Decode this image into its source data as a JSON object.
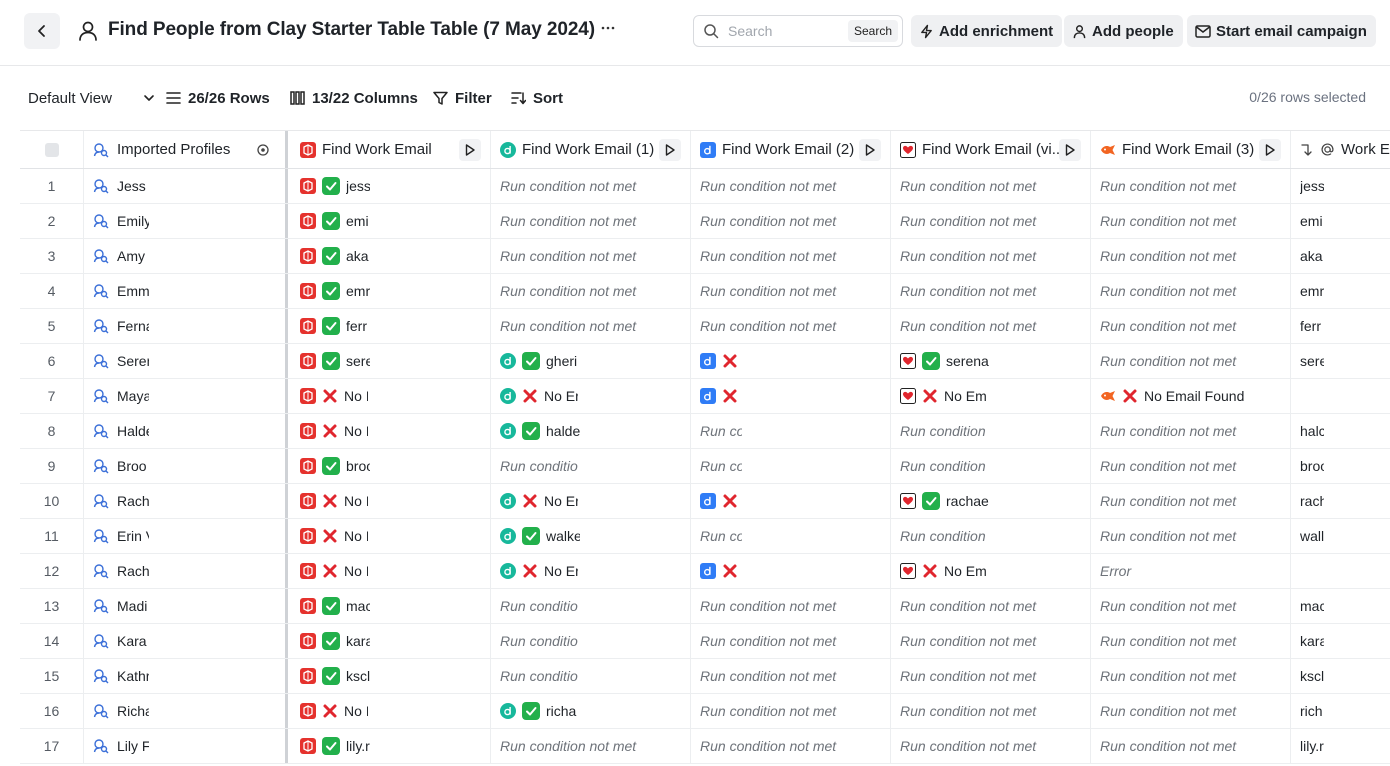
{
  "header": {
    "title": "Find People from Clay Starter Table Table (7 May 2024)",
    "search_placeholder": "Search",
    "search_button": "Search",
    "add_enrichment": "Add enrichment",
    "add_people": "Add people",
    "start_campaign": "Start email campaign"
  },
  "toolbar": {
    "view": "Default View",
    "rows": "26/26 Rows",
    "columns": "13/22 Columns",
    "filter": "Filter",
    "sort": "Sort",
    "rows_selected": "0/26 rows selected"
  },
  "colors": {
    "clay_red": "#e5322d",
    "dropcontact_teal": "#17b89b",
    "datagma_blue": "#2f7cf6",
    "hunter_orange": "#f26522",
    "check_green": "#22b04b",
    "x_red": "#e0262e"
  },
  "columns": {
    "profiles": "Imported Profiles",
    "e0": "Find Work Email",
    "e1": "Find Work Email (1)",
    "e2": "Find Work Email (2)",
    "e3": "Find Work Email (vi...",
    "e4": "Find Work Email (3)",
    "we": "Work E"
  },
  "text": {
    "cond": "Run condition not met",
    "cond_trunc_a": "Run conditic",
    "cond_trunc_b": "Run cc",
    "cond_trunc_c": "Run condition",
    "no_email": "No Email Found",
    "error": "Error"
  },
  "rows": [
    {
      "n": "1",
      "name": "Jess",
      "e0": "jess",
      "e0s": "ok",
      "e1": "cond",
      "e2": "cond",
      "e3": "cond",
      "e4": "cond",
      "we": "jess"
    },
    {
      "n": "2",
      "name": "Emily",
      "e0": "emi",
      "e0s": "ok",
      "e1": "cond",
      "e2": "cond",
      "e3": "cond",
      "e4": "cond",
      "we": "emi"
    },
    {
      "n": "3",
      "name": "Amy",
      "e0": "aka",
      "e0s": "ok",
      "e1": "cond",
      "e2": "cond",
      "e3": "cond",
      "e4": "cond",
      "we": "aka"
    },
    {
      "n": "4",
      "name": "Emm",
      "e0": "emr",
      "e0s": "ok",
      "e1": "cond",
      "e2": "cond",
      "e3": "cond",
      "e4": "cond",
      "we": "emr"
    },
    {
      "n": "5",
      "name": "Ferna",
      "e0": "ferr",
      "e0s": "ok",
      "e1": "cond",
      "e2": "cond",
      "e3": "cond",
      "e4": "cond",
      "we": "ferr"
    },
    {
      "n": "6",
      "name": "Seren",
      "e0": "sere",
      "e0s": "ok",
      "e1": "gheri",
      "e1s": "ok",
      "e2": "",
      "e2s": "x",
      "e3": "serena",
      "e3s": "ok",
      "e4": "cond",
      "we": "sere"
    },
    {
      "n": "7",
      "name": "Maya",
      "e0": "No I",
      "e0s": "x",
      "e1": "No Er",
      "e1s": "x",
      "e2": "",
      "e2s": "x",
      "e3": "No Em",
      "e3s": "x",
      "e4": "No Email Found",
      "e4s": "x",
      "we": ""
    },
    {
      "n": "8",
      "name": "Halde",
      "e0": "No I",
      "e0s": "x",
      "e1": "halde",
      "e1s": "ok",
      "e2": "condb",
      "e3": "condc",
      "e4": "cond",
      "we": "halc"
    },
    {
      "n": "9",
      "name": "Broo",
      "e0": "broo",
      "e0s": "ok",
      "e1": "conda",
      "e2": "condb",
      "e3": "condc",
      "e4": "cond",
      "we": "broo"
    },
    {
      "n": "10",
      "name": "Rach",
      "e0": "No I",
      "e0s": "x",
      "e1": "No Er",
      "e1s": "x",
      "e2": "",
      "e2s": "x",
      "e3": "rachae",
      "e3s": "ok",
      "e4": "cond",
      "we": "rach"
    },
    {
      "n": "11",
      "name": "Erin V",
      "e0": "No I",
      "e0s": "x",
      "e1": "walke",
      "e1s": "ok",
      "e2": "condb",
      "e3": "condc",
      "e4": "cond",
      "we": "wall"
    },
    {
      "n": "12",
      "name": "Rach",
      "e0": "No I",
      "e0s": "x",
      "e1": "No Er",
      "e1s": "x",
      "e2": "",
      "e2s": "x",
      "e3": "No Em",
      "e3s": "x",
      "e4": "error",
      "we": ""
    },
    {
      "n": "13",
      "name": "Madi",
      "e0": "mac",
      "e0s": "ok",
      "e1": "conda",
      "e2": "cond",
      "e3": "cond",
      "e4": "cond",
      "we": "mac"
    },
    {
      "n": "14",
      "name": "Kara",
      "e0": "kara",
      "e0s": "ok",
      "e1": "conda",
      "e2": "cond",
      "e3": "cond",
      "e4": "cond",
      "we": "kara"
    },
    {
      "n": "15",
      "name": "Kathr",
      "e0": "kscl",
      "e0s": "ok",
      "e1": "conda",
      "e2": "cond",
      "e3": "cond",
      "e4": "cond",
      "we": "kscl"
    },
    {
      "n": "16",
      "name": "Richa",
      "e0": "No I",
      "e0s": "x",
      "e1": "richa",
      "e1s": "ok",
      "e2": "cond",
      "e3": "cond",
      "e4": "cond",
      "we": "rich"
    },
    {
      "n": "17",
      "name": "Lily F",
      "e0": "lily.r",
      "e0s": "ok",
      "e1": "cond",
      "e2": "cond",
      "e3": "cond",
      "e4": "cond",
      "we": "lily.r"
    }
  ]
}
